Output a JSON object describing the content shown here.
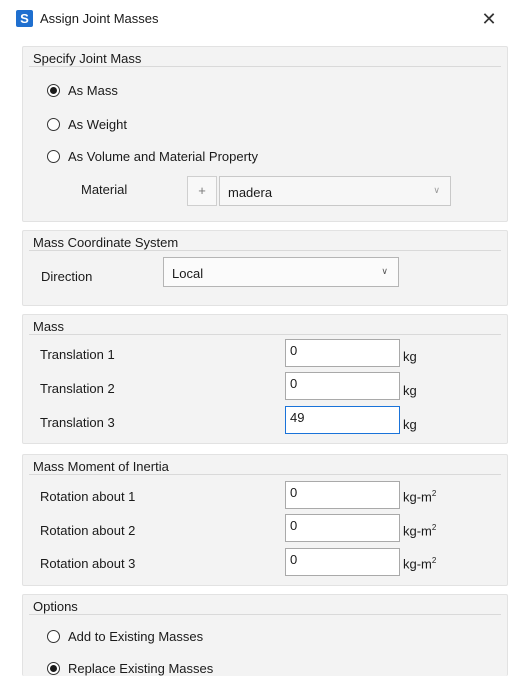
{
  "window": {
    "title": "Assign Joint Masses",
    "app_icon_letter": "S",
    "close_glyph": "✕"
  },
  "specify": {
    "title": "Specify Joint Mass",
    "options": [
      "As Mass",
      "As Weight",
      "As Volume and Material Property"
    ],
    "selected_index": 0,
    "material_label": "Material",
    "plus_label": "+",
    "material_value": "madera"
  },
  "coord": {
    "title": "Mass Coordinate System",
    "direction_label": "Direction",
    "direction_value": "Local"
  },
  "mass": {
    "title": "Mass",
    "rows": [
      {
        "label": "Translation 1",
        "value": "0",
        "unit": "kg"
      },
      {
        "label": "Translation 2",
        "value": "0",
        "unit": "kg"
      },
      {
        "label": "Translation 3",
        "value": "49",
        "unit": "kg"
      }
    ]
  },
  "inertia": {
    "title": "Mass Moment of Inertia",
    "rows": [
      {
        "label": "Rotation about 1",
        "value": "0",
        "unit": "kg-m",
        "unit_sup": "2"
      },
      {
        "label": "Rotation about 2",
        "value": "0",
        "unit": "kg-m",
        "unit_sup": "2"
      },
      {
        "label": "Rotation about 3",
        "value": "0",
        "unit": "kg-m",
        "unit_sup": "2"
      }
    ]
  },
  "options": {
    "title": "Options",
    "choices": [
      "Add to Existing Masses",
      "Replace Existing Masses"
    ],
    "selected_index": 1
  },
  "colors": {
    "accent": "#1f6fcf",
    "focus_border": "#1a73d9",
    "group_bg": "#f3f3f3"
  }
}
